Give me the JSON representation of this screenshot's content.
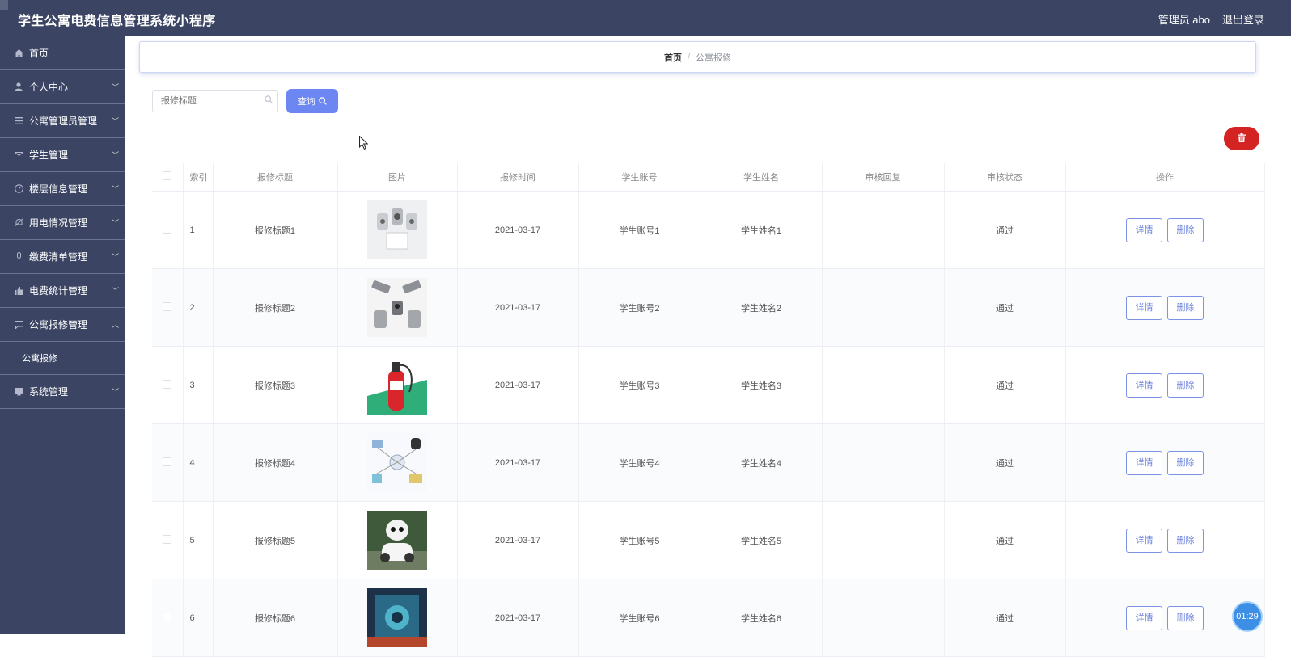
{
  "header": {
    "title": "学生公寓电费信息管理系统小程序",
    "user": "管理员 abo",
    "logout": "退出登录"
  },
  "sidebar": {
    "items": [
      {
        "label": "首页",
        "icon": "home-icon"
      },
      {
        "label": "个人中心",
        "icon": "user-icon"
      },
      {
        "label": "公寓管理员管理",
        "icon": "list-icon"
      },
      {
        "label": "学生管理",
        "icon": "mail-icon"
      },
      {
        "label": "楼层信息管理",
        "icon": "gauge-icon"
      },
      {
        "label": "用电情况管理",
        "icon": "bell-icon"
      },
      {
        "label": "缴费清单管理",
        "icon": "mic-icon"
      },
      {
        "label": "电费统计管理",
        "icon": "thumb-icon"
      },
      {
        "label": "公寓报修管理",
        "icon": "chat-icon"
      },
      {
        "label": "系统管理",
        "icon": "monitor-icon"
      }
    ],
    "sub_item": "公寓报修"
  },
  "breadcrumb": {
    "home": "首页",
    "separator": "/",
    "current": "公寓报修"
  },
  "search": {
    "placeholder": "报修标题",
    "button": "查询"
  },
  "table": {
    "headers": [
      "索引",
      "报修标题",
      "图片",
      "报修时间",
      "学生账号",
      "学生姓名",
      "审核回复",
      "审核状态",
      "操作"
    ],
    "rows": [
      {
        "index": "1",
        "title": "报修标题1",
        "time": "2021-03-17",
        "account": "学生账号1",
        "name": "学生姓名1",
        "reply": "",
        "status": "通过"
      },
      {
        "index": "2",
        "title": "报修标题2",
        "time": "2021-03-17",
        "account": "学生账号2",
        "name": "学生姓名2",
        "reply": "",
        "status": "通过"
      },
      {
        "index": "3",
        "title": "报修标题3",
        "time": "2021-03-17",
        "account": "学生账号3",
        "name": "学生姓名3",
        "reply": "",
        "status": "通过"
      },
      {
        "index": "4",
        "title": "报修标题4",
        "time": "2021-03-17",
        "account": "学生账号4",
        "name": "学生姓名4",
        "reply": "",
        "status": "通过"
      },
      {
        "index": "5",
        "title": "报修标题5",
        "time": "2021-03-17",
        "account": "学生账号5",
        "name": "学生姓名5",
        "reply": "",
        "status": "通过"
      },
      {
        "index": "6",
        "title": "报修标题6",
        "time": "2021-03-17",
        "account": "学生账号6",
        "name": "学生姓名6",
        "reply": "",
        "status": "通过"
      }
    ],
    "detail_label": "详情",
    "delete_label": "删除"
  },
  "timer": "01:29",
  "colors": {
    "header_bg": "#3b4563",
    "primary": "#6c87f1",
    "danger": "#d32323"
  }
}
